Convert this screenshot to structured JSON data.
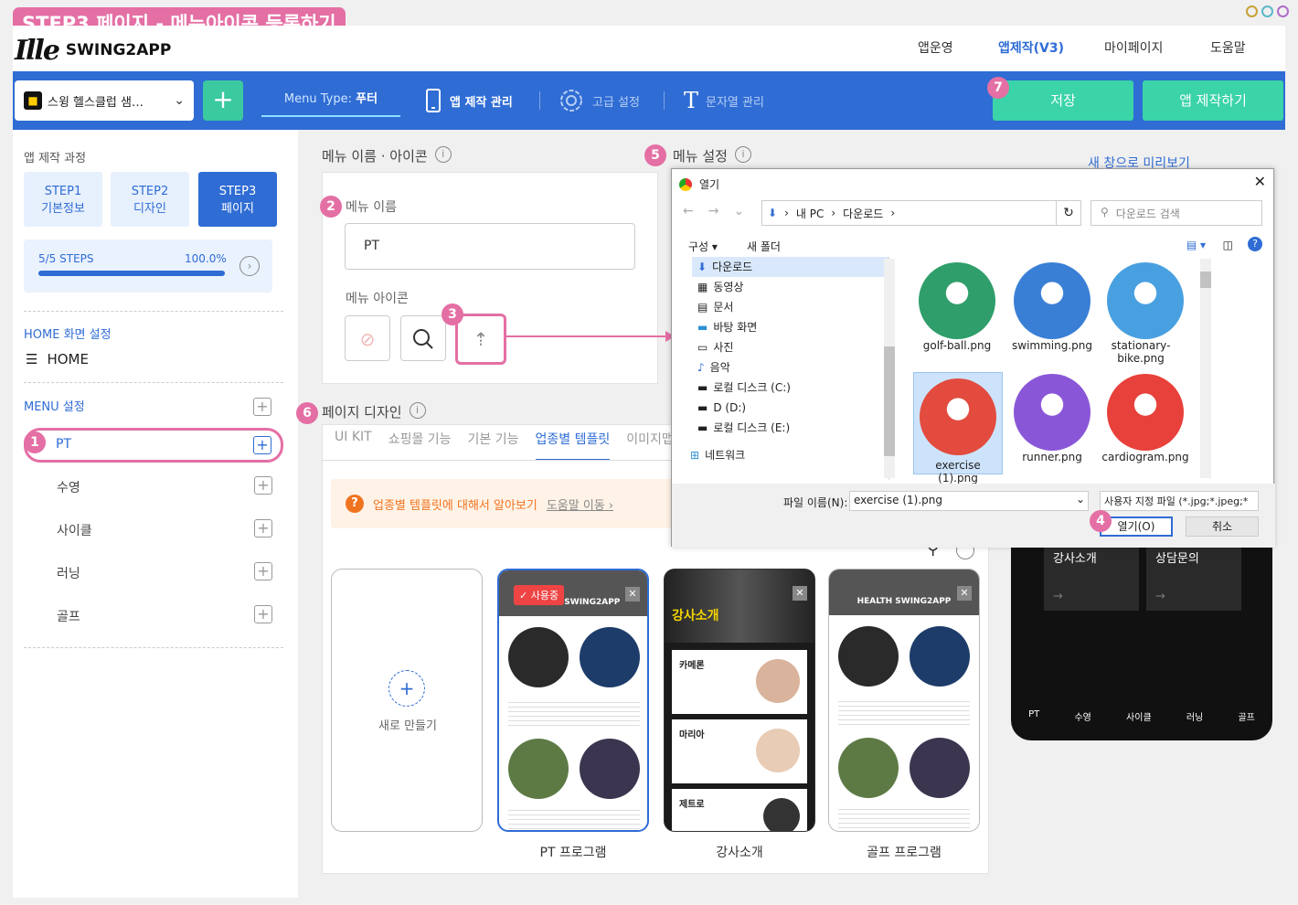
{
  "step_title": "STEP3 페이지 - 메뉴아이콘 등록하기",
  "brand": {
    "mark": "Ille",
    "name": "SWING2APP"
  },
  "top_nav": [
    "앱운영",
    "앱제작(V3)",
    "마이페이지",
    "도움말"
  ],
  "toolbar": {
    "app_name": "스윙 헬스클럽 샘…",
    "add_label": "+",
    "menu_type_label": "Menu Type:",
    "menu_type_value": "푸터",
    "items": [
      "앱 제작 관리",
      "고급 설정",
      "문자열 관리"
    ],
    "save_label": "저장",
    "build_label": "앱 제작하기"
  },
  "badges": [
    "1",
    "2",
    "3",
    "4",
    "5",
    "6",
    "7"
  ],
  "sidebar": {
    "process_title": "앱 제작 과정",
    "steps": [
      {
        "l1": "STEP1",
        "l2": "기본정보"
      },
      {
        "l1": "STEP2",
        "l2": "디자인"
      },
      {
        "l1": "STEP3",
        "l2": "페이지"
      }
    ],
    "progress_label": "5/5 STEPS",
    "progress_pct": "100.0%",
    "progress_value": 1.0,
    "home_title": "HOME 화면 설정",
    "home_item": "HOME",
    "menu_title": "MENU 설정",
    "menu_items": [
      "PT",
      "수영",
      "사이클",
      "러닝",
      "골프"
    ]
  },
  "menu_icon_panel": {
    "title": "메뉴 이름 · 아이콘",
    "name_label": "메뉴 이름",
    "name_value": "PT",
    "icon_label": "메뉴 아이콘"
  },
  "menu_settings": {
    "title": "메뉴 설정",
    "preview_link": "새 창으로 미리보기"
  },
  "page_design": {
    "title": "페이지 디자인",
    "tabs": [
      "UI KIT",
      "쇼핑몰 기능",
      "기본 기능",
      "업종별 템플릿",
      "이미지맵"
    ],
    "notice": "업종별 템플릿에 대해서 알아보기",
    "notice_link": "도움말 이동",
    "new_label": "새로 만들기",
    "in_use": "사용중",
    "templates": [
      "PT 프로그램",
      "강사소개",
      "골프 프로그램"
    ],
    "card_heading": "HEALTH SWING2APP",
    "card_trainer_heading": "강사소개",
    "trainers": [
      "카메론",
      "마리아",
      "제트로"
    ]
  },
  "file_dialog": {
    "title": "열기",
    "path": [
      "내 PC",
      "다운로드"
    ],
    "search_placeholder": "다운로드 검색",
    "organize": "구성",
    "new_folder": "새 폴더",
    "tree": [
      "다운로드",
      "동영상",
      "문서",
      "바탕 화면",
      "사진",
      "음악",
      "로컬 디스크 (C:)",
      "D (D:)",
      "로컬 디스크 (E:)",
      "네트워크"
    ],
    "files": [
      {
        "name": "golf-ball.png",
        "color": "#2f9e6a"
      },
      {
        "name": "swimming.png",
        "color": "#3a7fd6"
      },
      {
        "name": "stationary-bike.png",
        "color": "#49a0e0"
      },
      {
        "name": "exercise (1).png",
        "color": "#e24b3e"
      },
      {
        "name": "runner.png",
        "color": "#8a56d8"
      },
      {
        "name": "cardiogram.png",
        "color": "#e8403a"
      }
    ],
    "selected_file": "exercise (1).png",
    "filename_label": "파일 이름(N):",
    "filename_value": "exercise (1).png",
    "filter_value": "사용자 지정 파일 (*.jpg;*.jpeg;*",
    "open_label": "열기(O)",
    "cancel_label": "취소"
  },
  "phone_preview": {
    "tiles": [
      "강사소개",
      "상담문의"
    ],
    "footer": [
      "PT",
      "수영",
      "사이클",
      "러닝",
      "골프"
    ]
  },
  "colors": {
    "brand_blue": "#2f6cd4",
    "accent_pink": "#e46fa4",
    "green": "#3bd3a8"
  }
}
